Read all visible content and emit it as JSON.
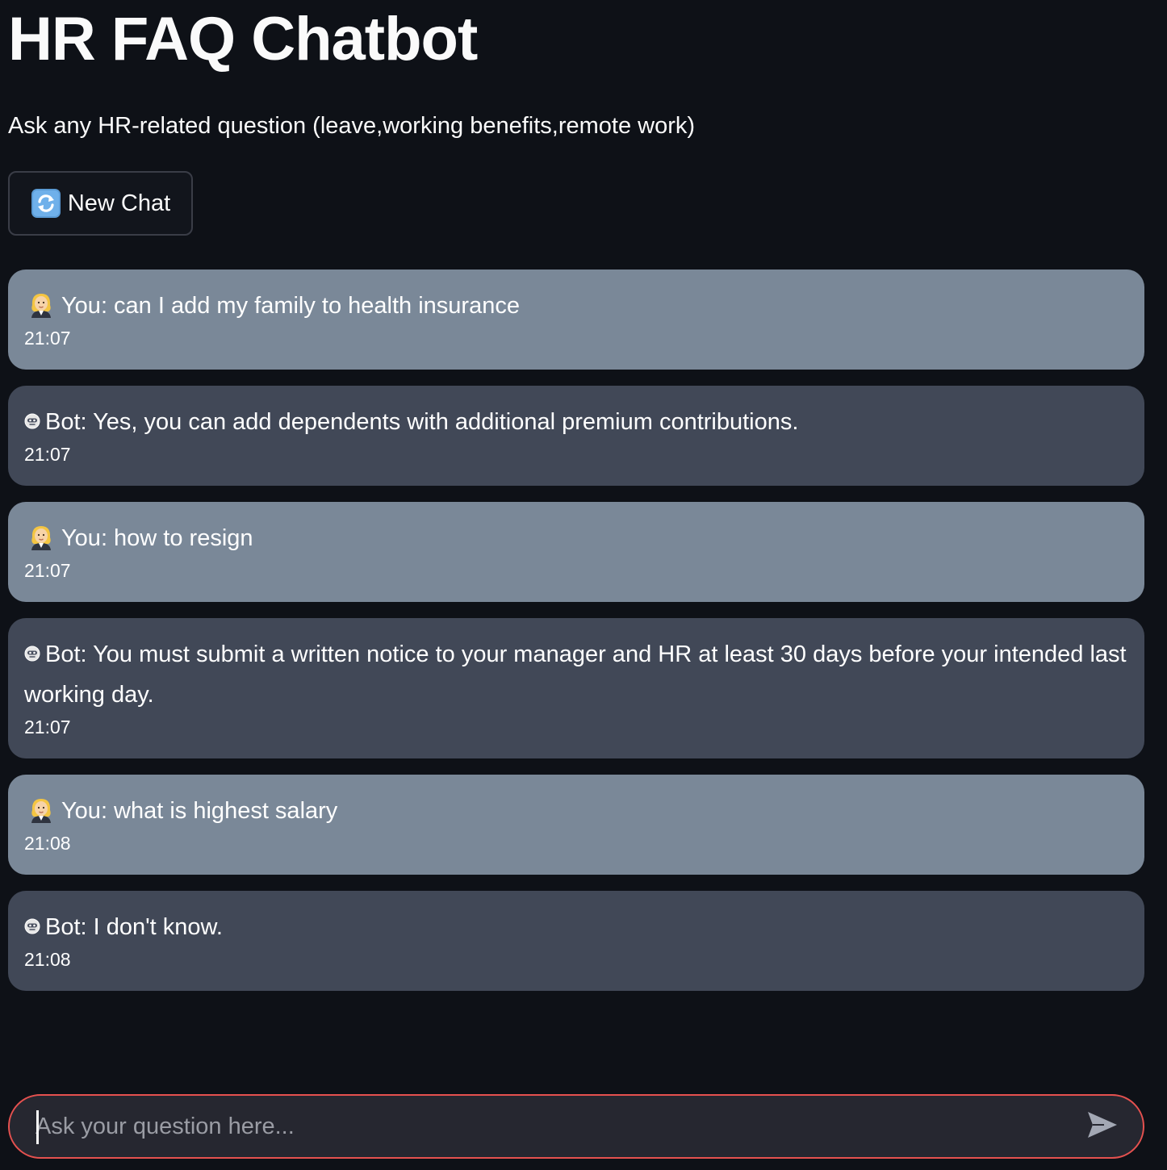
{
  "header": {
    "title": "HR FAQ Chatbot",
    "subtitle": "Ask any HR-related question (leave,working benefits,remote work)"
  },
  "toolbar": {
    "new_chat_label": "New Chat",
    "new_chat_icon": "refresh-icon"
  },
  "messages": [
    {
      "role": "user",
      "icon": "user-emoji-icon",
      "text": "You: can I add my family to health insurance",
      "time": "21:07"
    },
    {
      "role": "bot",
      "icon": "bot-emoji-icon",
      "text": "Bot: Yes, you can add dependents with additional premium contributions.",
      "time": "21:07"
    },
    {
      "role": "user",
      "icon": "user-emoji-icon",
      "text": "You: how to resign",
      "time": "21:07"
    },
    {
      "role": "bot",
      "icon": "bot-emoji-icon",
      "text": "Bot: You must submit a written notice to your manager and HR at least 30 days before your intended last working day.",
      "time": "21:07"
    },
    {
      "role": "user",
      "icon": "user-emoji-icon",
      "text": "You: what is highest salary",
      "time": "21:08"
    },
    {
      "role": "bot",
      "icon": "bot-emoji-icon",
      "text": "Bot: I don't know.",
      "time": "21:08"
    }
  ],
  "input": {
    "placeholder": "Ask your question here...",
    "value": "",
    "send_icon": "send-icon",
    "focus_border_color": "#e5514f"
  },
  "colors": {
    "background": "#0e1117",
    "user_bubble": "#7a8898",
    "bot_bubble": "#414857"
  }
}
